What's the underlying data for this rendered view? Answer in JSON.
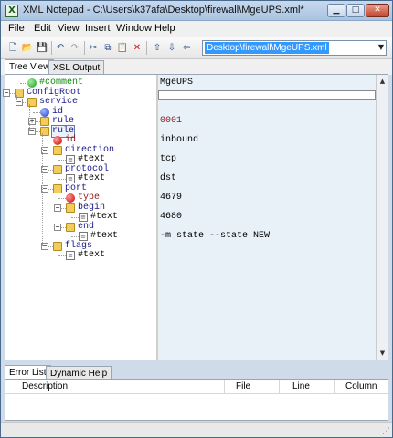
{
  "window": {
    "title": "XML Notepad - C:\\Users\\k37afa\\Desktop\\firewall\\MgeUPS.xml*"
  },
  "menu": [
    "File",
    "Edit",
    "View",
    "Insert",
    "Window",
    "Help"
  ],
  "toolbar": {
    "path_value": "Desktop\\firewall\\MgeUPS.xml",
    "icons": [
      "new-file-icon",
      "open-folder-icon",
      "save-icon",
      "undo-icon",
      "redo-icon",
      "cut-icon",
      "copy-icon",
      "paste-icon",
      "delete-icon",
      "nudge-up-icon",
      "nudge-down-icon",
      "nudge-left-icon",
      "nudge-right-icon"
    ]
  },
  "tabs": {
    "tree_view": "Tree View",
    "xsl_output": "XSL Output"
  },
  "tree": [
    {
      "label": "#comment",
      "kind": "comment",
      "value": "MgeUPS"
    },
    {
      "label": "ConfigRoot",
      "kind": "element",
      "value": ""
    },
    {
      "label": "service",
      "kind": "element",
      "value": ""
    },
    {
      "label": "id",
      "kind": "attr-blue",
      "value": ""
    },
    {
      "label": "rule",
      "kind": "element",
      "value": "0001"
    },
    {
      "label": "rule",
      "kind": "element",
      "value": ""
    },
    {
      "label": "id",
      "kind": "attr",
      "value": "inbound"
    },
    {
      "label": "direction",
      "kind": "element",
      "value": ""
    },
    {
      "label": "#text",
      "kind": "text",
      "value": "tcp"
    },
    {
      "label": "protocol",
      "kind": "element",
      "value": ""
    },
    {
      "label": "#text",
      "kind": "text",
      "value": "dst"
    },
    {
      "label": "port",
      "kind": "element",
      "value": ""
    },
    {
      "label": "type",
      "kind": "attr",
      "value": "4679"
    },
    {
      "label": "begin",
      "kind": "element",
      "value": ""
    },
    {
      "label": "#text",
      "kind": "text",
      "value": "4680"
    },
    {
      "label": "end",
      "kind": "element",
      "value": ""
    },
    {
      "label": "#text",
      "kind": "text",
      "value": "-m state --state NEW"
    },
    {
      "label": "flags",
      "kind": "element",
      "value": ""
    },
    {
      "label": "#text",
      "kind": "text",
      "value": ""
    }
  ],
  "bottom": {
    "tabs": [
      "Error List",
      "Dynamic Help"
    ],
    "columns": [
      "Description",
      "File",
      "Line",
      "Column"
    ]
  },
  "colors": {
    "selection": "#3399ff",
    "value_pane": "#e8f0f8",
    "window_frame": "#cfdbe9"
  }
}
